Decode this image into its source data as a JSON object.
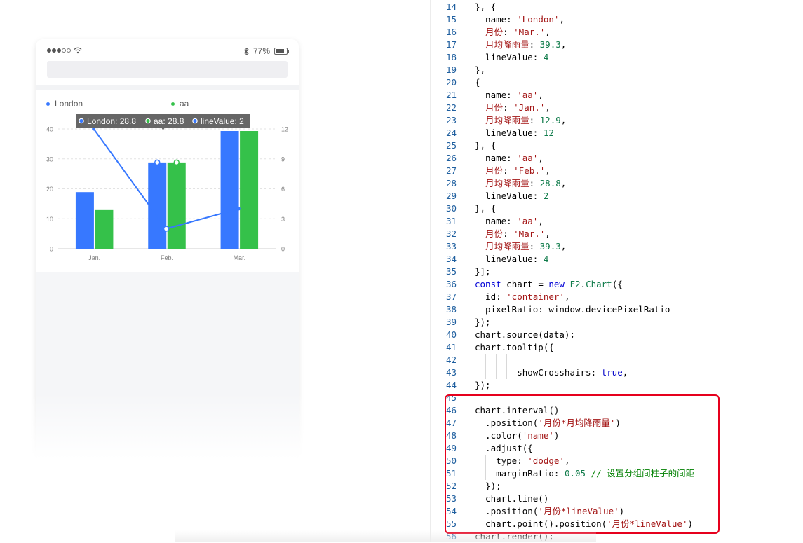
{
  "phone": {
    "status": {
      "battery": "77%"
    },
    "legend": [
      {
        "name": "London",
        "color": "#3778ff"
      },
      {
        "name": "aa",
        "color": "#35c14a"
      }
    ],
    "tooltip": [
      {
        "label": "London: 28.8"
      },
      {
        "label": "aa: 28.8"
      },
      {
        "label": "lineValue: 2"
      }
    ]
  },
  "chart_data": {
    "type": "bar",
    "categories": [
      "Jan.",
      "Feb.",
      "Mar."
    ],
    "series": [
      {
        "name": "London",
        "values": [
          18.9,
          28.8,
          39.3
        ],
        "color": "#3778ff"
      },
      {
        "name": "aa",
        "values": [
          12.9,
          28.8,
          39.3
        ],
        "color": "#35c14a"
      }
    ],
    "line": {
      "name": "lineValue",
      "values": [
        12,
        2,
        4
      ],
      "color": "#3778ff"
    },
    "ylim": [
      0,
      40
    ],
    "yticks": [
      "0",
      "10",
      "20",
      "30",
      "40"
    ],
    "y2lim": [
      0,
      12
    ],
    "y2ticks": [
      "0",
      "3",
      "6",
      "9",
      "12"
    ],
    "tooltip_category": "Feb.",
    "grid": true,
    "legend_position": "top"
  },
  "editor": {
    "lines": [
      {
        "n": "14",
        "html": "}, {"
      },
      {
        "n": "15",
        "html": "  name: <span class=\"s\">'London'</span>,"
      },
      {
        "n": "16",
        "html": "  <span class=\"s\">月份</span>: <span class=\"s\">'Mar.'</span>,"
      },
      {
        "n": "17",
        "html": "  <span class=\"s\">月均降雨量</span>: <span class=\"n\">39.3</span>,"
      },
      {
        "n": "18",
        "html": "  lineValue: <span class=\"n\">4</span>"
      },
      {
        "n": "19",
        "html": "},"
      },
      {
        "n": "20",
        "html": "{"
      },
      {
        "n": "21",
        "html": "  name: <span class=\"s\">'aa'</span>,"
      },
      {
        "n": "22",
        "html": "  <span class=\"s\">月份</span>: <span class=\"s\">'Jan.'</span>,"
      },
      {
        "n": "23",
        "html": "  <span class=\"s\">月均降雨量</span>: <span class=\"n\">12.9</span>,"
      },
      {
        "n": "24",
        "html": "  lineValue: <span class=\"n\">12</span>"
      },
      {
        "n": "25",
        "html": "}, {"
      },
      {
        "n": "26",
        "html": "  name: <span class=\"s\">'aa'</span>,"
      },
      {
        "n": "27",
        "html": "  <span class=\"s\">月份</span>: <span class=\"s\">'Feb.'</span>,"
      },
      {
        "n": "28",
        "html": "  <span class=\"s\">月均降雨量</span>: <span class=\"n\">28.8</span>,"
      },
      {
        "n": "29",
        "html": "  lineValue: <span class=\"n\">2</span>"
      },
      {
        "n": "30",
        "html": "}, {"
      },
      {
        "n": "31",
        "html": "  name: <span class=\"s\">'aa'</span>,"
      },
      {
        "n": "32",
        "html": "  <span class=\"s\">月份</span>: <span class=\"s\">'Mar.'</span>,"
      },
      {
        "n": "33",
        "html": "  <span class=\"s\">月均降雨量</span>: <span class=\"n\">39.3</span>,"
      },
      {
        "n": "34",
        "html": "  lineValue: <span class=\"n\">4</span>"
      },
      {
        "n": "35",
        "html": "}];"
      },
      {
        "n": "36",
        "html": "<span class=\"k\">const</span> chart = <span class=\"k\">new</span> <span class=\"n\">F2</span>.<span class=\"n\">Chart</span>({"
      },
      {
        "n": "37",
        "html": "  id: <span class=\"s\">'container'</span>,"
      },
      {
        "n": "38",
        "html": "  pixelRatio: window.devicePixelRatio"
      },
      {
        "n": "39",
        "html": "});"
      },
      {
        "n": "40",
        "html": "chart.source(data);"
      },
      {
        "n": "41",
        "html": "chart.tooltip({"
      },
      {
        "n": "42",
        "html": ""
      },
      {
        "n": "43",
        "html": "        showCrosshairs: <span class=\"bool\">true</span>,"
      },
      {
        "n": "44",
        "html": "});"
      },
      {
        "n": "45",
        "html": ""
      },
      {
        "n": "46",
        "html": "chart.interval()"
      },
      {
        "n": "47",
        "html": "  .position(<span class=\"s\">'月份*月均降雨量'</span>)"
      },
      {
        "n": "48",
        "html": "  .color(<span class=\"s\">'name'</span>)"
      },
      {
        "n": "49",
        "html": "  .adjust({"
      },
      {
        "n": "50",
        "html": "    type: <span class=\"s\">'dodge'</span>,"
      },
      {
        "n": "51",
        "html": "    marginRatio: <span class=\"n\">0.05</span> <span class=\"c\">// 设置分组间柱子的间距</span>"
      },
      {
        "n": "52",
        "html": "  });"
      },
      {
        "n": "53",
        "html": "  chart.line()"
      },
      {
        "n": "54",
        "html": "  .position(<span class=\"s\">'月份*lineValue'</span>)"
      },
      {
        "n": "55",
        "html": "  chart.point().position(<span class=\"s\">'月份*lineValue'</span>)"
      },
      {
        "n": "56",
        "html": "chart.render();"
      }
    ]
  }
}
